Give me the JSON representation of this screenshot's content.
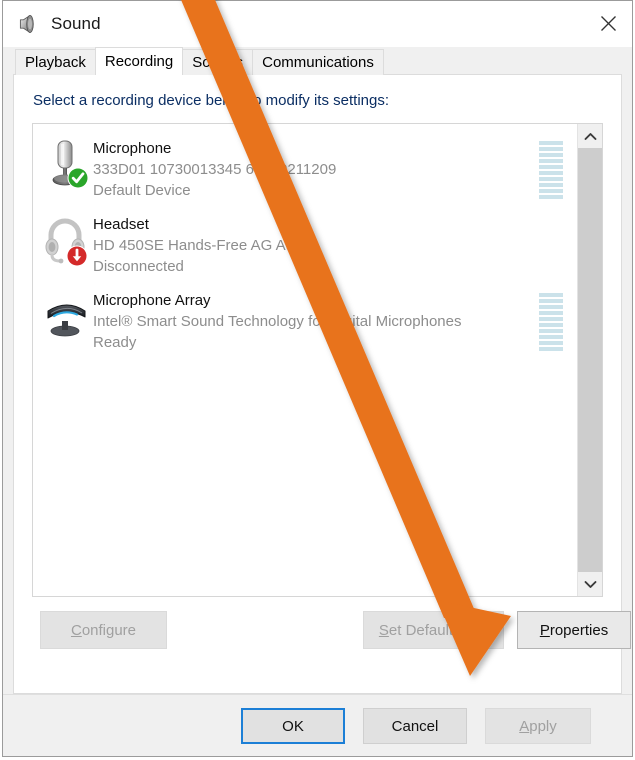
{
  "window": {
    "title": "Sound",
    "icon": "speaker-icon",
    "close_label": "✕"
  },
  "tabs": [
    {
      "label": "Playback",
      "selected": false
    },
    {
      "label": "Recording",
      "selected": true
    },
    {
      "label": "Sounds",
      "selected": false
    },
    {
      "label": "Communications",
      "selected": false
    }
  ],
  "page": {
    "hint": "Select a recording device below to modify its settings:"
  },
  "devices": [
    {
      "icon": "usb-microphone-icon",
      "badge": "green-check-badge",
      "name": "Microphone",
      "description": "333D01 10730013345 65520211209",
      "status": "Default Device",
      "meter_segments": 10,
      "meter_visible": true
    },
    {
      "icon": "headset-icon",
      "badge": "red-down-arrow-badge",
      "name": "Headset",
      "description": "HD 450SE Hands-Free AG Audio",
      "status": "Disconnected",
      "meter_segments": 0,
      "meter_visible": false
    },
    {
      "icon": "microphone-array-icon",
      "badge": "none",
      "name": "Microphone Array",
      "description": "Intel® Smart Sound Technology for Digital Microphones",
      "status": "Ready",
      "meter_segments": 10,
      "meter_visible": true
    }
  ],
  "scrollbar": {
    "up_glyph": "˄",
    "down_glyph": "˅"
  },
  "buttons": {
    "configure": {
      "label": "Configure",
      "accel": "C",
      "disabled": true
    },
    "set_default": {
      "label": "Set Default",
      "accel": "S",
      "disabled": true
    },
    "set_default_dropdown": {
      "label": "▼",
      "disabled": true
    },
    "properties": {
      "label": "Properties",
      "accel": "P",
      "disabled": false
    },
    "ok": {
      "label": "OK",
      "default": true
    },
    "cancel": {
      "label": "Cancel"
    },
    "apply": {
      "label": "Apply",
      "accel": "A",
      "disabled": true
    }
  },
  "annotation": {
    "type": "arrow",
    "color": "#E8731E",
    "points_to": "properties-button"
  },
  "colors": {
    "accent": "#1c7fd6",
    "annotation_orange": "#E8731E",
    "hint_text": "#0b2e63",
    "meter_fill": "#cbe2ea",
    "default_badge_green": "#2aa62a",
    "disconnected_badge_red": "#d42a2a"
  }
}
